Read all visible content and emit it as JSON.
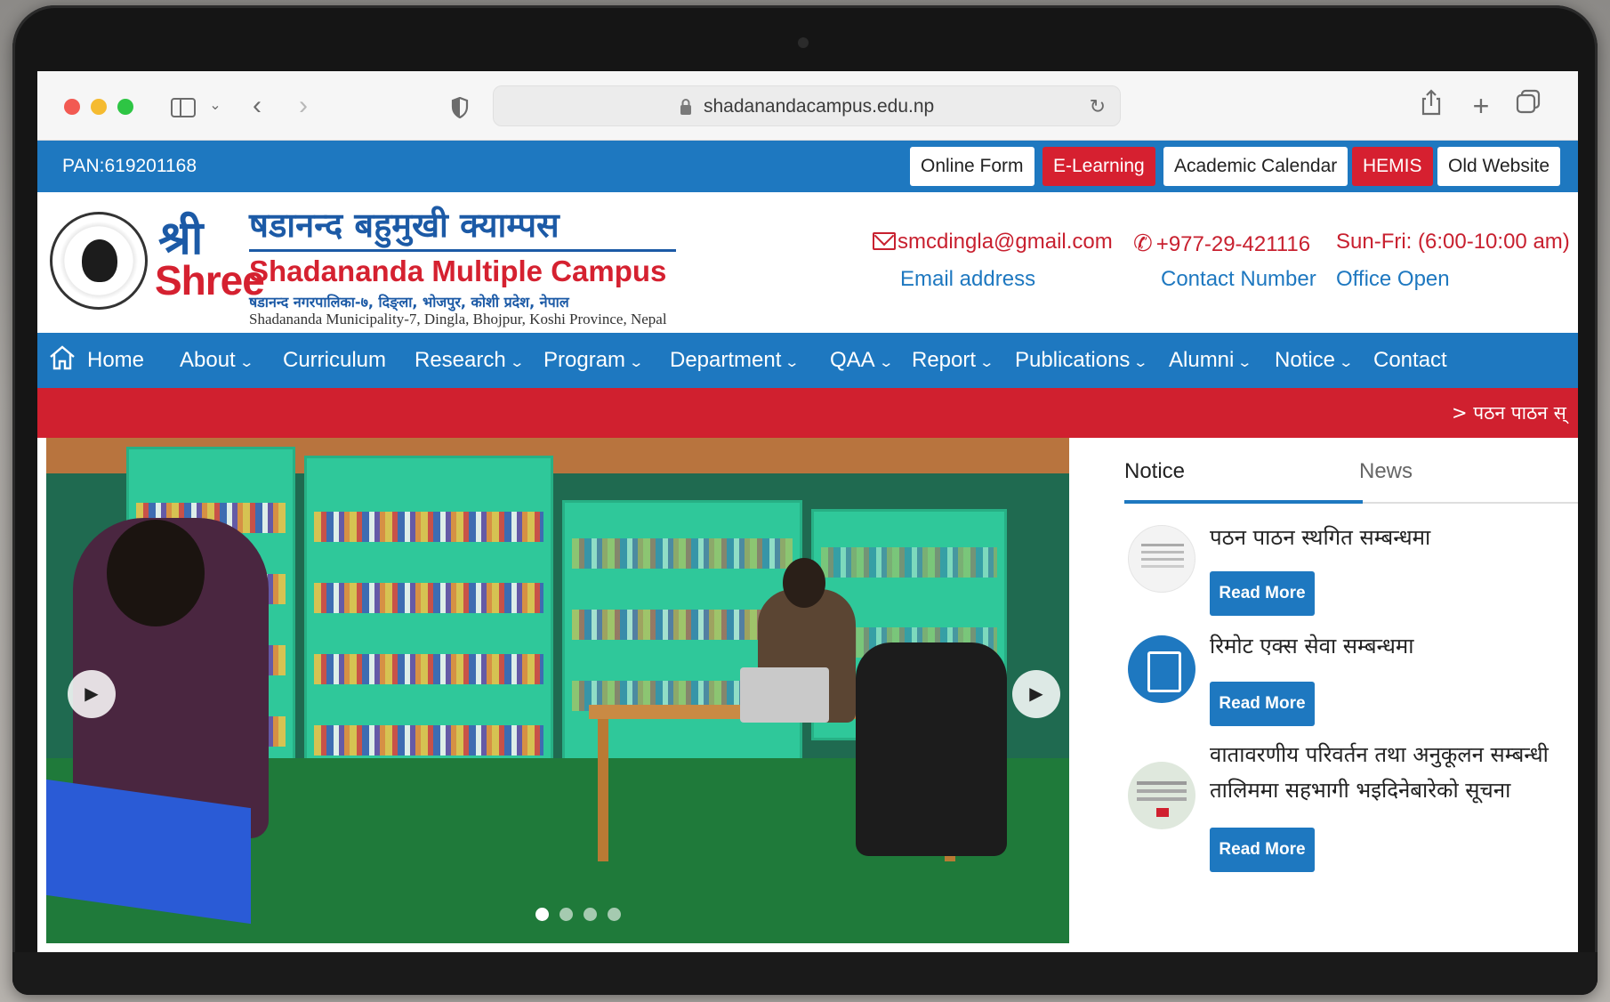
{
  "browser": {
    "url": "shadanandacampus.edu.np"
  },
  "topbar": {
    "pan": "PAN:619201168",
    "buttons": [
      "Online Form",
      "E-Learning",
      "Academic Calendar",
      "HEMIS",
      "Old Website"
    ]
  },
  "header": {
    "shree_dev": "श्री",
    "shree_en": "Shree",
    "name_dev": "षडानन्द बहुमुखी क्याम्पस",
    "name_en": "Shadananda Multiple Campus",
    "address_dev": "षडानन्द नगरपालिका-७, दिङ्ला, भोजपुर, कोशी प्रदेश, नेपाल",
    "address_en": "Shadananda Municipality-7, Dingla, Bhojpur, Koshi Province, Nepal",
    "email": "smcdingla@gmail.com",
    "email_label": "Email address",
    "phone": "+977-29-421116",
    "phone_label": "Contact Number",
    "hours": "Sun-Fri: (6:00-10:00 am)",
    "hours_label": "Office Open"
  },
  "nav": {
    "items": [
      "Home",
      "About",
      "Curriculum",
      "Research",
      "Program",
      "Department",
      "QAA",
      "Report",
      "Publications",
      "Alumni",
      "Notice",
      "Contact"
    ]
  },
  "ticker": {
    "text": "> पठन पाठन स्"
  },
  "slider": {
    "slides": 4,
    "active_slide": 1
  },
  "panel": {
    "tabs": [
      "Notice",
      "News"
    ],
    "active_tab": "Notice",
    "items": [
      {
        "title": "पठन पाठन स्थगित सम्बन्धमा",
        "button": "Read More"
      },
      {
        "title": "रिमोट एक्स सेवा सम्बन्धमा",
        "button": "Read More"
      },
      {
        "title": "वातावरणीय परिवर्तन तथा अनुकूलन सम्बन्धी तालिममा सहभागी भइदिनेबारेको सूचना",
        "button": "Read More"
      }
    ]
  },
  "colors": {
    "primary_blue": "#1e78c0",
    "accent_red": "#d0202f"
  }
}
